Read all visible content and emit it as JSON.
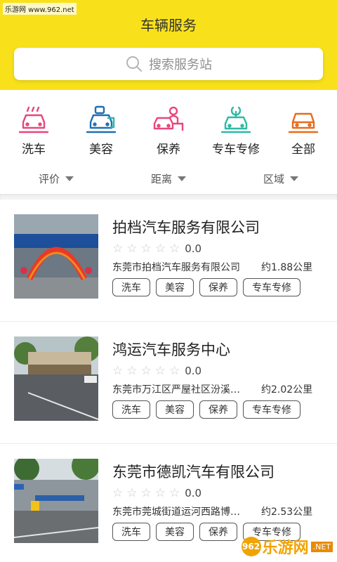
{
  "watermark_top": "乐游网 www.962.net",
  "header": {
    "title": "车辆服务"
  },
  "search": {
    "placeholder": "搜索服务站"
  },
  "categories": [
    {
      "label": "洗车",
      "icon": "car-wash-icon",
      "color": "#e8467c"
    },
    {
      "label": "美容",
      "icon": "car-beauty-icon",
      "color": "#1f6fb4"
    },
    {
      "label": "保养",
      "icon": "car-maintenance-icon",
      "color": "#e8467c"
    },
    {
      "label": "专车专修",
      "icon": "car-repair-icon",
      "color": "#2db9a4"
    },
    {
      "label": "全部",
      "icon": "car-all-icon",
      "color": "#e86b1a"
    }
  ],
  "filters": [
    {
      "label": "评价"
    },
    {
      "label": "距离"
    },
    {
      "label": "区域"
    }
  ],
  "stations": [
    {
      "name": "拍档汽车服务有限公司",
      "rating": "0.0",
      "address": "东莞市拍档汽车服务有限公司",
      "distance": "约1.88公里",
      "tags": [
        "洗车",
        "美容",
        "保养",
        "专车专修"
      ]
    },
    {
      "name": "鸿运汽车服务中心",
      "rating": "0.0",
      "address": "东莞市万江区严屋社区汾溪…",
      "distance": "约2.02公里",
      "tags": [
        "洗车",
        "美容",
        "保养",
        "专车专修"
      ]
    },
    {
      "name": "东莞市德凯汽车有限公司",
      "rating": "0.0",
      "address": "东莞市莞城街道运河西路博…",
      "distance": "约2.53公里",
      "tags": [
        "洗车",
        "美容",
        "保养",
        "专车专修"
      ]
    }
  ],
  "watermark_bottom": {
    "logo": "962",
    "text": "乐游网",
    "sub": ".NET"
  }
}
